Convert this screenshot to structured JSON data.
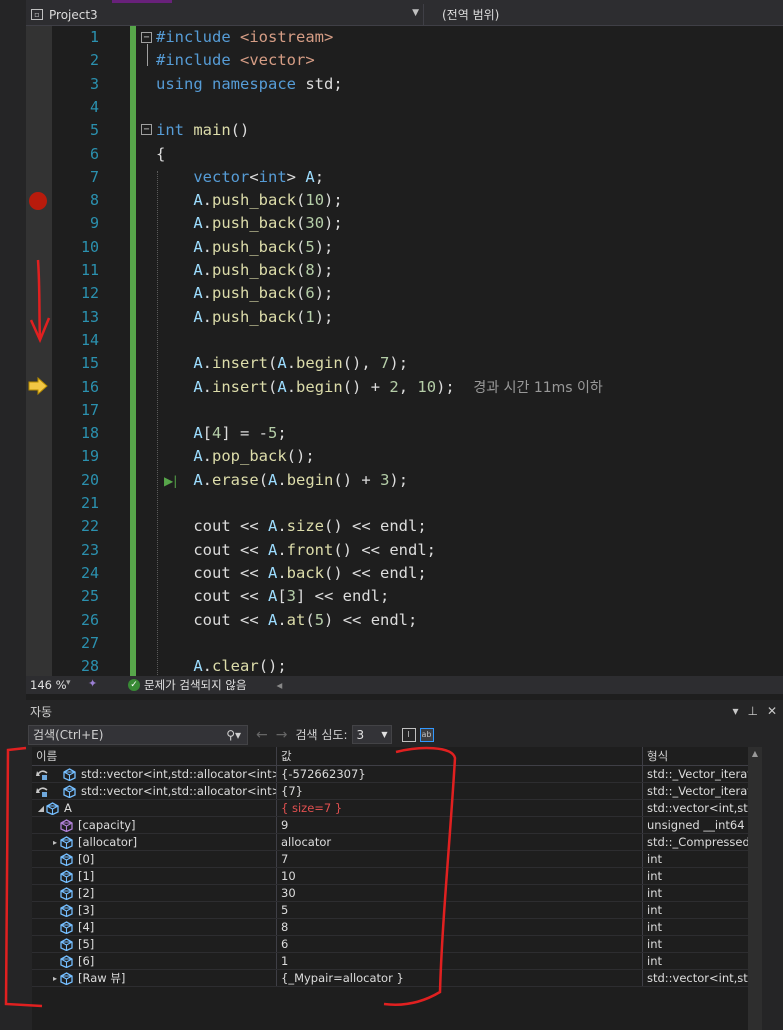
{
  "topbar": {
    "project": "Project3",
    "scope": "(전역 범위)"
  },
  "editor": {
    "lines": [
      {
        "n": "1"
      },
      {
        "n": "2"
      },
      {
        "n": "3"
      },
      {
        "n": "4"
      },
      {
        "n": "5"
      },
      {
        "n": "6"
      },
      {
        "n": "7"
      },
      {
        "n": "8"
      },
      {
        "n": "9"
      },
      {
        "n": "10"
      },
      {
        "n": "11"
      },
      {
        "n": "12"
      },
      {
        "n": "13"
      },
      {
        "n": "14"
      },
      {
        "n": "15"
      },
      {
        "n": "16"
      },
      {
        "n": "17"
      },
      {
        "n": "18"
      },
      {
        "n": "19"
      },
      {
        "n": "20"
      },
      {
        "n": "21"
      },
      {
        "n": "22"
      },
      {
        "n": "23"
      },
      {
        "n": "24"
      },
      {
        "n": "25"
      },
      {
        "n": "26"
      },
      {
        "n": "27"
      },
      {
        "n": "28"
      }
    ],
    "hint": "경과 시간 11ms 이하"
  },
  "status": {
    "zoom": "146 %",
    "problems": "문제가 검색되지 않음"
  },
  "auto": {
    "title": "자동",
    "search_placeholder": "검색(Ctrl+E)",
    "depth_label": "검색 심도:",
    "depth_value": "3",
    "headers": {
      "name": "이름",
      "value": "값",
      "type": "형식"
    },
    "rows": [
      {
        "name": "std::vector<int,std::allocator<int> >::...",
        "value": "{-572662307}",
        "type": "std::_Vector_iterator..."
      },
      {
        "name": "std::vector<int,std::allocator<int> >::...",
        "value": "{7}",
        "type": "std::_Vector_iterator..."
      },
      {
        "name": "A",
        "value": "{ size=7 }",
        "type": "std::vector<int,std::..."
      },
      {
        "name": "[capacity]",
        "value": "9",
        "type": "unsigned __int64"
      },
      {
        "name": "[allocator]",
        "value": "allocator",
        "type": "std::_Compressed_p..."
      },
      {
        "name": "[0]",
        "value": "7",
        "type": "int"
      },
      {
        "name": "[1]",
        "value": "10",
        "type": "int"
      },
      {
        "name": "[2]",
        "value": "30",
        "type": "int"
      },
      {
        "name": "[3]",
        "value": "5",
        "type": "int"
      },
      {
        "name": "[4]",
        "value": "8",
        "type": "int"
      },
      {
        "name": "[5]",
        "value": "6",
        "type": "int"
      },
      {
        "name": "[6]",
        "value": "1",
        "type": "int"
      },
      {
        "name": "[Raw 뷰]",
        "value": "{_Mypair=allocator }",
        "type": "std::vector<int,std::..."
      }
    ]
  }
}
